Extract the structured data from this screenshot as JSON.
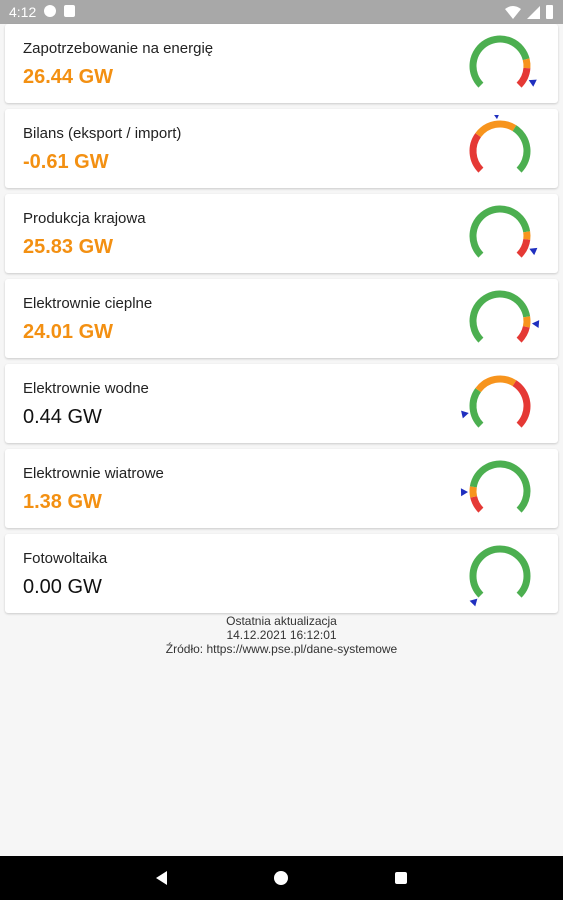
{
  "statusbar": {
    "time": "4:12"
  },
  "colors": {
    "green": "#4caf50",
    "orange": "#f7941d",
    "red": "#e53935",
    "marker": "#1f2fbf",
    "value_orange": "#f39012"
  },
  "cards": [
    {
      "label": "Zapotrzebowanie na energię",
      "value": "26.44 GW",
      "value_style": "orange",
      "gauge": {
        "segments": [
          [
            "green",
            0,
            0.78
          ],
          [
            "orange",
            0.78,
            0.85
          ],
          [
            "red",
            0.85,
            1.0
          ]
        ],
        "marker": 0.93,
        "marker_side": "right"
      }
    },
    {
      "label": "Bilans (eksport / import)",
      "value": "-0.61 GW",
      "value_style": "orange",
      "gauge": {
        "segments": [
          [
            "red",
            0,
            0.3
          ],
          [
            "orange",
            0.3,
            0.62
          ],
          [
            "green",
            0.62,
            1.0
          ]
        ],
        "marker": 0.48,
        "marker_side": "top"
      }
    },
    {
      "label": "Produkcja krajowa",
      "value": "25.83 GW",
      "value_style": "orange",
      "gauge": {
        "segments": [
          [
            "green",
            0,
            0.8
          ],
          [
            "orange",
            0.8,
            0.86
          ],
          [
            "red",
            0.86,
            1.0
          ]
        ],
        "marker": 0.92,
        "marker_side": "right"
      }
    },
    {
      "label": "Elektrownie cieplne",
      "value": "24.01 GW",
      "value_style": "orange",
      "gauge": {
        "segments": [
          [
            "green",
            0,
            0.8
          ],
          [
            "orange",
            0.8,
            0.88
          ],
          [
            "red",
            0.88,
            1.0
          ]
        ],
        "marker": 0.85,
        "marker_side": "right"
      }
    },
    {
      "label": "Elektrownie wodne",
      "value": "0.44 GW",
      "value_style": "plain",
      "gauge": {
        "segments": [
          [
            "green",
            0,
            0.3
          ],
          [
            "orange",
            0.3,
            0.62
          ],
          [
            "red",
            0.62,
            1.0
          ]
        ],
        "marker": 0.12,
        "marker_side": "left"
      }
    },
    {
      "label": "Elektrownie wiatrowe",
      "value": "1.38 GW",
      "value_style": "orange",
      "gauge": {
        "segments": [
          [
            "red",
            0,
            0.12
          ],
          [
            "orange",
            0.12,
            0.2
          ],
          [
            "green",
            0.2,
            1.0
          ]
        ],
        "marker": 0.16,
        "marker_side": "left"
      }
    },
    {
      "label": "Fotowoltaika",
      "value": "0.00 GW",
      "value_style": "plain",
      "gauge": {
        "segments": [
          [
            "green",
            0,
            1.0
          ]
        ],
        "marker": 0.0,
        "marker_side": "left"
      }
    }
  ],
  "footer": {
    "line1": "Ostatnia aktualizacja",
    "line2": "14.12.2021 16:12:01",
    "line3": "Źródło: https://www.pse.pl/dane-systemowe"
  }
}
